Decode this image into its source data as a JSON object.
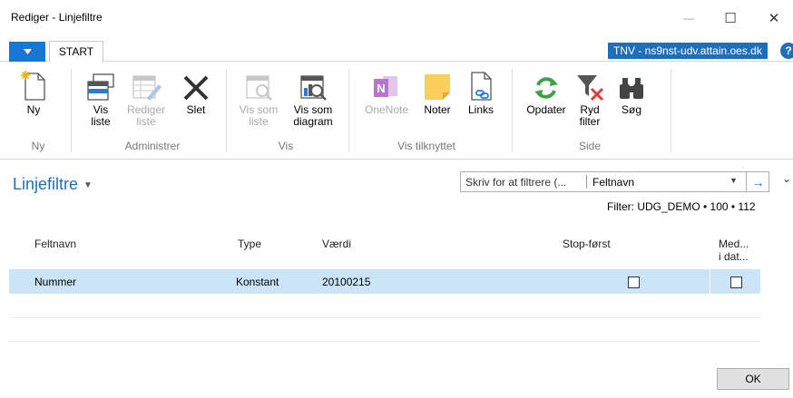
{
  "window": {
    "title": "Rediger - Linjefiltre",
    "minimize": "—",
    "maximize": "☐",
    "close": "✕"
  },
  "tabs": {
    "menu": "▼",
    "start": "START"
  },
  "server": "TNV - ns9nst-udv.attain.oes.dk",
  "help": "?",
  "ribbon": {
    "groups": {
      "ny": "Ny",
      "administrer": "Administrer",
      "vis": "Vis",
      "vis_tilknyttet": "Vis tilknyttet",
      "side": "Side"
    },
    "buttons": {
      "ny": "Ny",
      "vis_liste": [
        "Vis",
        "liste"
      ],
      "rediger_liste": [
        "Rediger",
        "liste"
      ],
      "slet": "Slet",
      "vis_som_liste": [
        "Vis som",
        "liste"
      ],
      "vis_som_diagram": [
        "Vis som",
        "diagram"
      ],
      "onenote": "OneNote",
      "noter": "Noter",
      "links": "Links",
      "opdater": "Opdater",
      "ryd_filter": [
        "Ryd",
        "filter"
      ],
      "soeg": "Søg"
    }
  },
  "page": {
    "title": "Linjefiltre",
    "title_caret": "▼",
    "search_placeholder": "Skriv for at filtrere (...",
    "search_field": "Feltnavn",
    "filter_info": "Filter: UDG_DEMO • 100 • 112"
  },
  "table": {
    "columns": {
      "feltnavn": "Feltnavn",
      "type": "Type",
      "vaerdi": "Værdi",
      "stop_foerst": "Stop-først",
      "med": [
        "Med...",
        "i dat..."
      ]
    },
    "rows": [
      {
        "feltnavn": "Nummer",
        "type": "Konstant",
        "vaerdi": "20100215",
        "stop_foerst": false,
        "med": false
      }
    ]
  },
  "ok": "OK"
}
